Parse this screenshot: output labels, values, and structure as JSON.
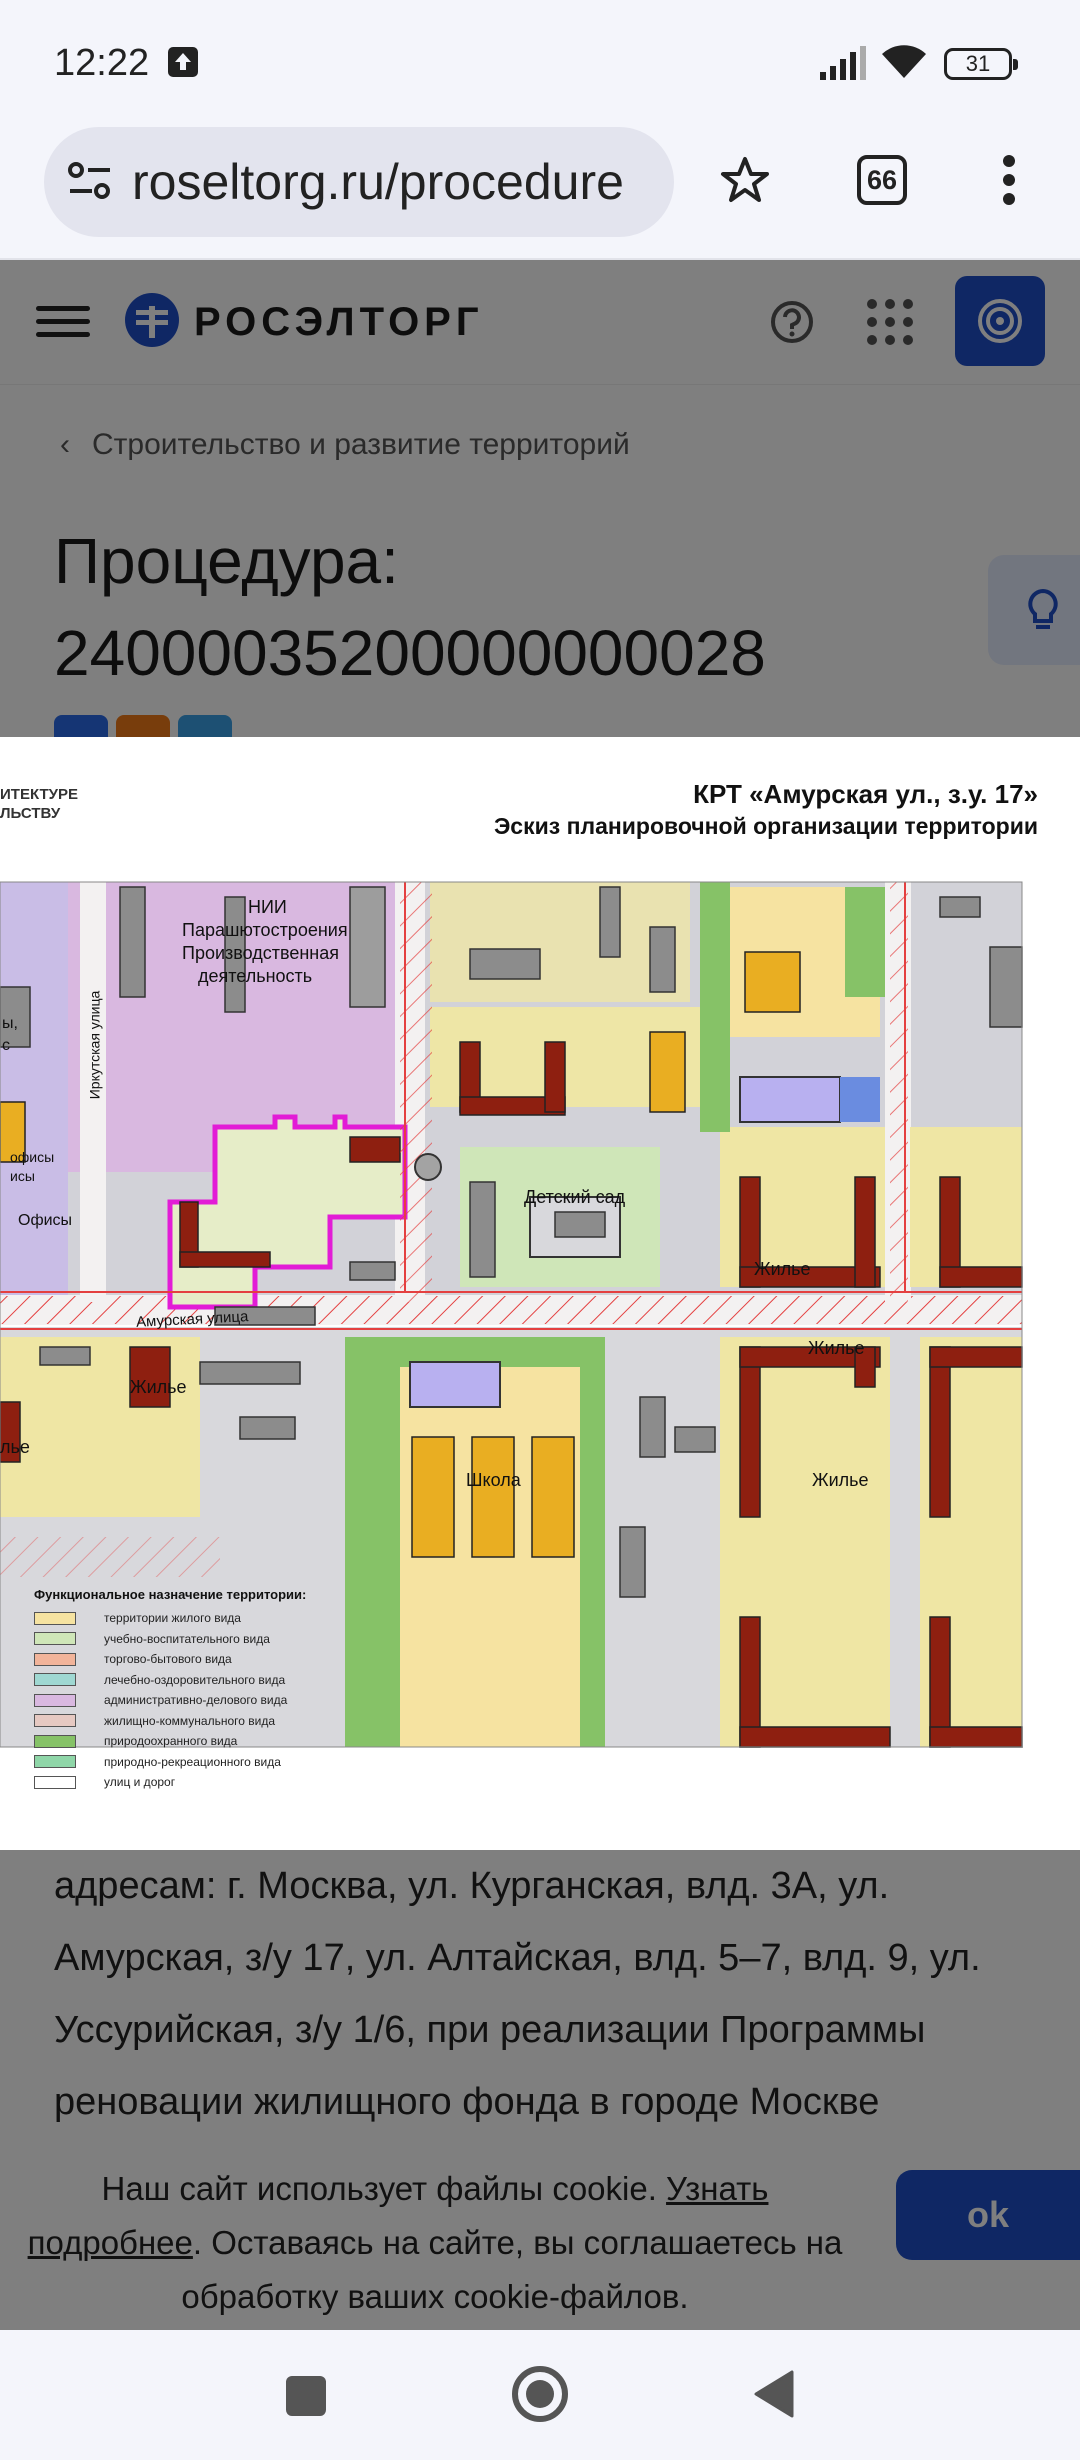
{
  "status_bar": {
    "time": "12:22",
    "battery": "31"
  },
  "browser": {
    "url": "roseltorg.ru/procedure",
    "tab_count": "66"
  },
  "site": {
    "logo_text": "РОСЭЛТОРГ",
    "breadcrumb": "Строительство и развитие территорий",
    "title_line1": "Процедура:",
    "title_line2": "24000035200000000028",
    "description": "адресам: г. Москва, ул. Курганская, влд. 3А, ул. Амурская, з/у 17, ул. Алтайская, влд. 5–7, влд. 9, ул. Уссурийская, з/у 1/6, при реализации Программы реновации жилищного фонда в городе Москве"
  },
  "cookie": {
    "text_before": "Наш сайт использует файлы cookie. ",
    "link": "Узнать подробнее",
    "text_after": ". Оставаясь на сайте, вы соглашаетесь на обработку ваших cookie-файлов.",
    "ok_label": "ok"
  },
  "map": {
    "header_left_1": "ИТЕКТУРЕ",
    "header_left_2": "ЛЬСТВУ",
    "title": "КРТ «Амурская ул., з.у. 17»",
    "subtitle": "Эскиз планировочной организации территории",
    "labels": {
      "nii": "НИИ",
      "parashyut": "Парашютостроения",
      "proizv": "Производственная",
      "deyat": "деятельность",
      "irkutskaya": "Иркутская улица",
      "detsad": "Детский сад",
      "amurskaya": "Амурская улица",
      "zhilye1": "Жилье",
      "zhilye2": "Жилье",
      "zhilye3": "Жилье",
      "zhilye4": "Жилье",
      "zhilye5": "лье",
      "shkola": "Школа",
      "ofisy1": "офисы",
      "ofisy2": "исы",
      "ofisy3": "Офисы",
      "left_y": "ы,",
      "left_s": "с"
    },
    "legend_title": "Функциональное назначение территории:",
    "legend": [
      {
        "label": "территории жилого вида",
        "color": "#f6e3a1"
      },
      {
        "label": "учебно-воспитательного вида",
        "color": "#cfe6b8"
      },
      {
        "label": "торгово-бытового вида",
        "color": "#f2b49a"
      },
      {
        "label": "лечебно-оздоровительного вида",
        "color": "#9fd8d2"
      },
      {
        "label": "административно-делового вида",
        "color": "#d9b8e0"
      },
      {
        "label": "жилищно-коммунального вида",
        "color": "#e6c9c2"
      },
      {
        "label": "природоохранного вида",
        "color": "#86c267"
      },
      {
        "label": "природно-рекреационного вида",
        "color": "#8fd6a8"
      },
      {
        "label": "улиц и дорог",
        "color": "#ffffff"
      }
    ]
  }
}
